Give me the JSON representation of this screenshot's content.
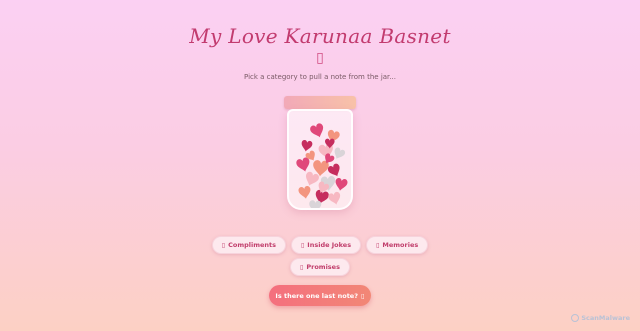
{
  "header": {
    "title": "My Love Karunaa Basnet",
    "icon_glyph": "▯",
    "subtitle": "Pick a category to pull a note from the jar..."
  },
  "jar": {
    "lid_color": "#f5b3b2",
    "heart_colors": [
      "#e0487a",
      "#f3957f",
      "#c62e5f",
      "#f7b8c2",
      "#d9d4d8"
    ]
  },
  "categories": [
    {
      "icon": "▯",
      "label": "Compliments"
    },
    {
      "icon": "▯",
      "label": "Inside Jokes"
    },
    {
      "icon": "▯",
      "label": "Memories"
    },
    {
      "icon": "▯",
      "label": "Promises"
    }
  ],
  "last_note_button": {
    "label": "Is there one last note?",
    "icon": "▯"
  },
  "watermark": {
    "text": "ScanMalware"
  },
  "colors": {
    "accent": "#c23b6f",
    "button": "#f46f7e",
    "pill_bg": "#fde9ee"
  }
}
